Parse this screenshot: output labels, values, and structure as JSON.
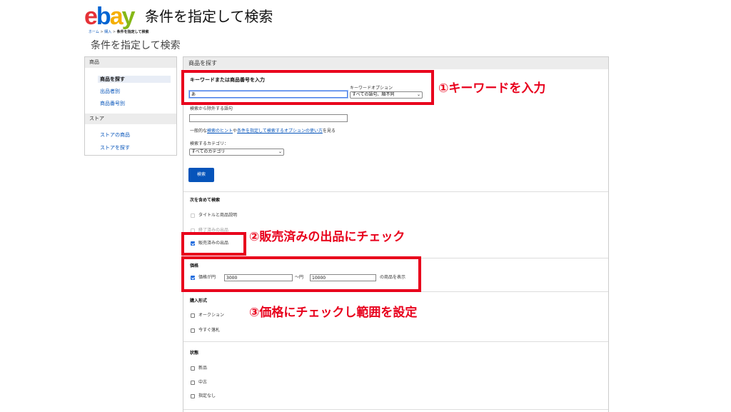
{
  "header": {
    "logo": {
      "e": "e",
      "b": "b",
      "a": "a",
      "y": "y"
    },
    "title": "条件を指定して検索",
    "breadcrumb": {
      "home": "ホーム",
      "sep1": " > ",
      "buy": "購入",
      "sep2": " > ",
      "current": "条件を指定して検索"
    },
    "page_title": "条件を指定して検索"
  },
  "sidebar": {
    "section_items": "商品",
    "items": [
      "商品を探す",
      "出品者別",
      "商品番号別"
    ],
    "section_store": "ストア",
    "store_items": [
      "ストアの商品",
      "ストアを探す"
    ]
  },
  "panel": {
    "header": "商品を探す",
    "keyword_label": "キーワードまたは商品番号を入力",
    "keyword_value": "あ",
    "keyword_option_label": "キーワードオプション",
    "keyword_option_value": "すべての語句、順不同",
    "exclude_label": "検索から除外する語句",
    "exclude_value": "",
    "help": {
      "prefix": "一般的な",
      "link1": "検索のヒント",
      "mid": "や",
      "link2": "条件を指定して検索するオプションの使い方",
      "suffix": "を見る"
    },
    "category_label": "検索するカテゴリ：",
    "category_value": "すべてのカテゴリ",
    "search_button": "検索",
    "include_heading": "次を含めて検索",
    "include_options": [
      {
        "label": "タイトルと商品説明",
        "checked": false
      },
      {
        "label": "終了済みの出品",
        "checked": false
      },
      {
        "label": "販売済みの出品",
        "checked": true
      }
    ],
    "price_heading": "価格",
    "price_label": "価格が円",
    "price_min": "3000",
    "price_between": "〜円",
    "price_max": "10000",
    "price_suffix": "の商品を表示",
    "format_heading": "購入形式",
    "format_options": [
      "オークション",
      "今すぐ落札"
    ],
    "condition_heading": "状態",
    "condition_options": [
      "新品",
      "中古",
      "指定なし"
    ]
  },
  "annotations": {
    "color": "#e8001c",
    "step1": "①キーワードを入力",
    "step2": "②販売済みの出品にチェック",
    "step3": "③価格にチェックし範囲を設定"
  }
}
